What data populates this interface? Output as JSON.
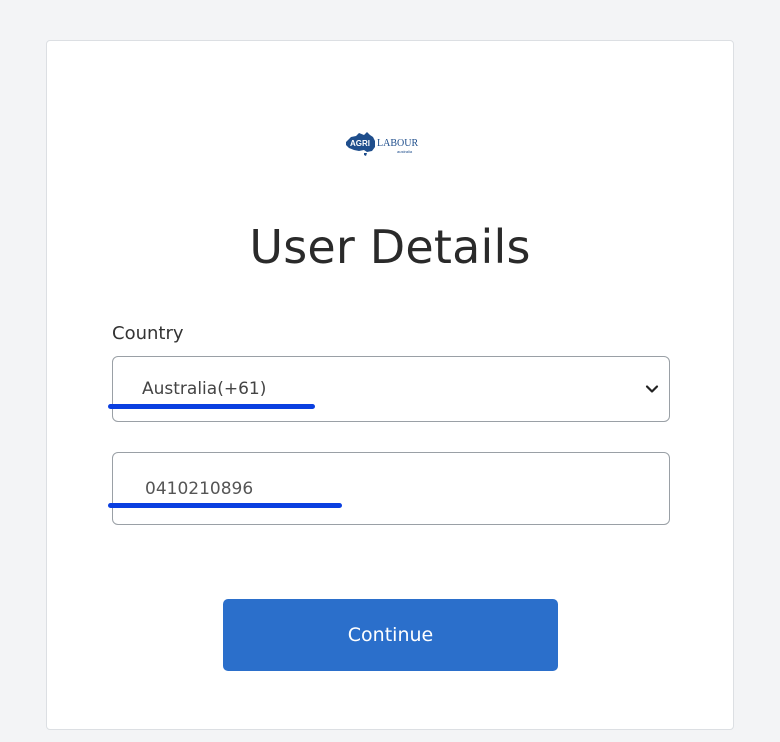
{
  "logo": {
    "text_agri": "AGRI",
    "text_labour": "LABOUR",
    "text_sub": "australia",
    "brand_color": "#1f4e8c"
  },
  "page": {
    "title": "User Details"
  },
  "form": {
    "country_label": "Country",
    "country_value": "Australia(+61)",
    "phone_value": "0410210896"
  },
  "actions": {
    "continue_label": "Continue"
  },
  "colors": {
    "accent": "#2b6fcb",
    "annotation": "#0a3fe0"
  }
}
